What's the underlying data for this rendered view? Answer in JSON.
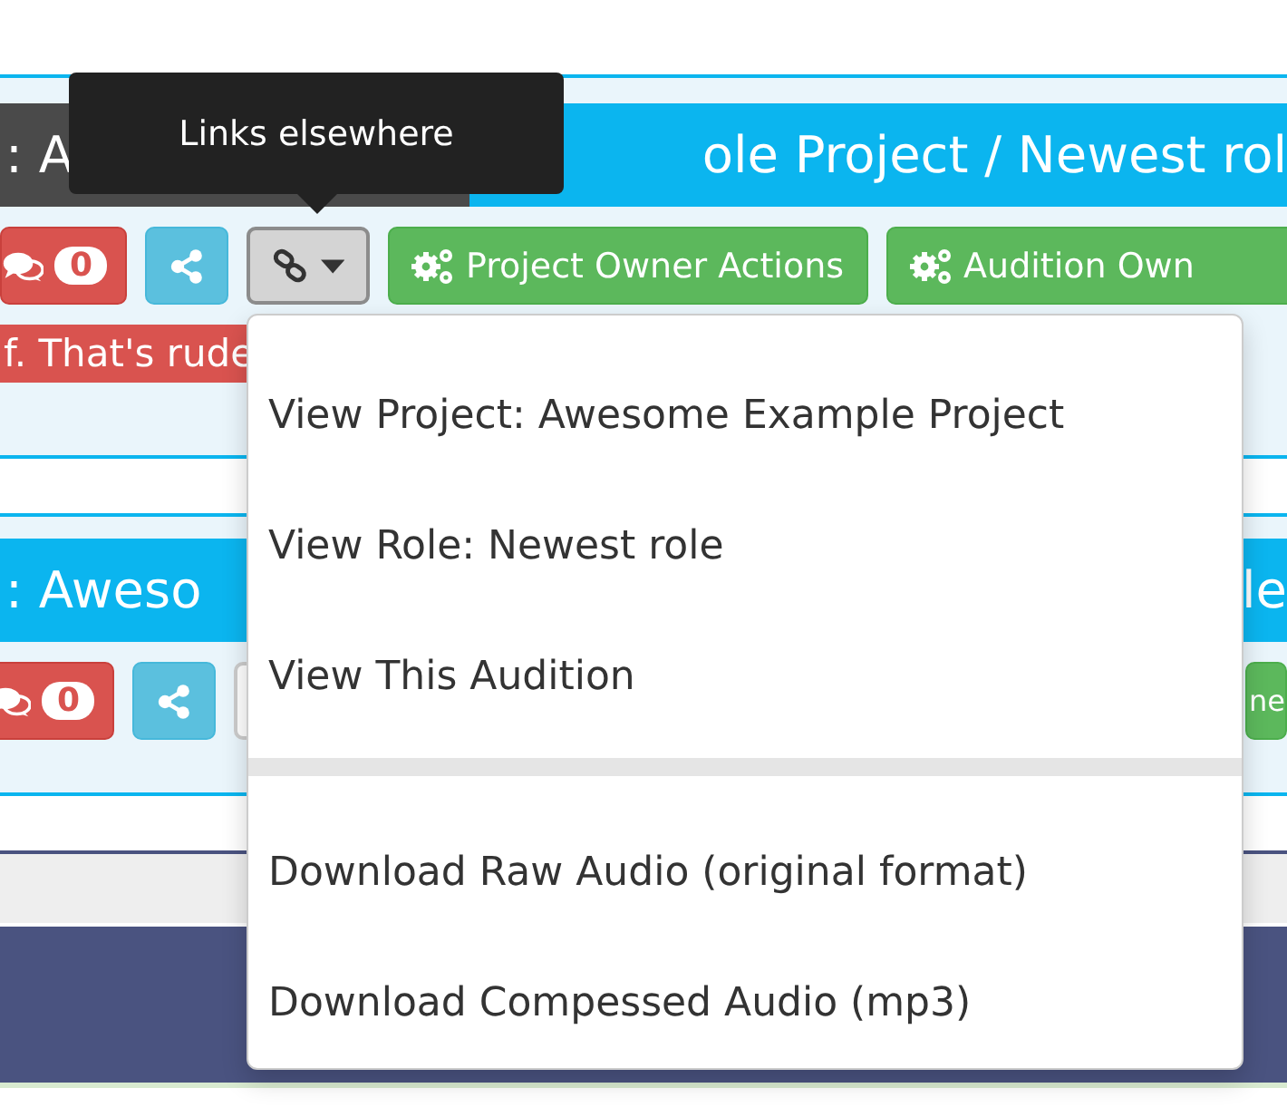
{
  "cards": [
    {
      "title": [
        {
          "text": ": A",
          "highlighted": true
        },
        {
          "text": "ole Project / Newest rol",
          "highlighted": false
        }
      ],
      "comment_count": "0",
      "links_open": true,
      "actions": [
        "Project Owner Actions",
        "Audition Own"
      ],
      "notice": "f. That's rude"
    },
    {
      "title": [
        {
          "text": ": Aweso",
          "highlighted": false
        },
        {
          "text": "le",
          "highlighted": false
        }
      ],
      "comment_count": "0",
      "actions": [
        "ne"
      ]
    }
  ],
  "tooltip": "Links elsewhere",
  "menu": {
    "groups": [
      [
        "View Project: Awesome Example Project",
        "View Role: Newest role",
        "View This Audition"
      ],
      [
        "Download Raw Audio (original format)",
        "Download Compessed Audio (mp3)"
      ]
    ]
  }
}
